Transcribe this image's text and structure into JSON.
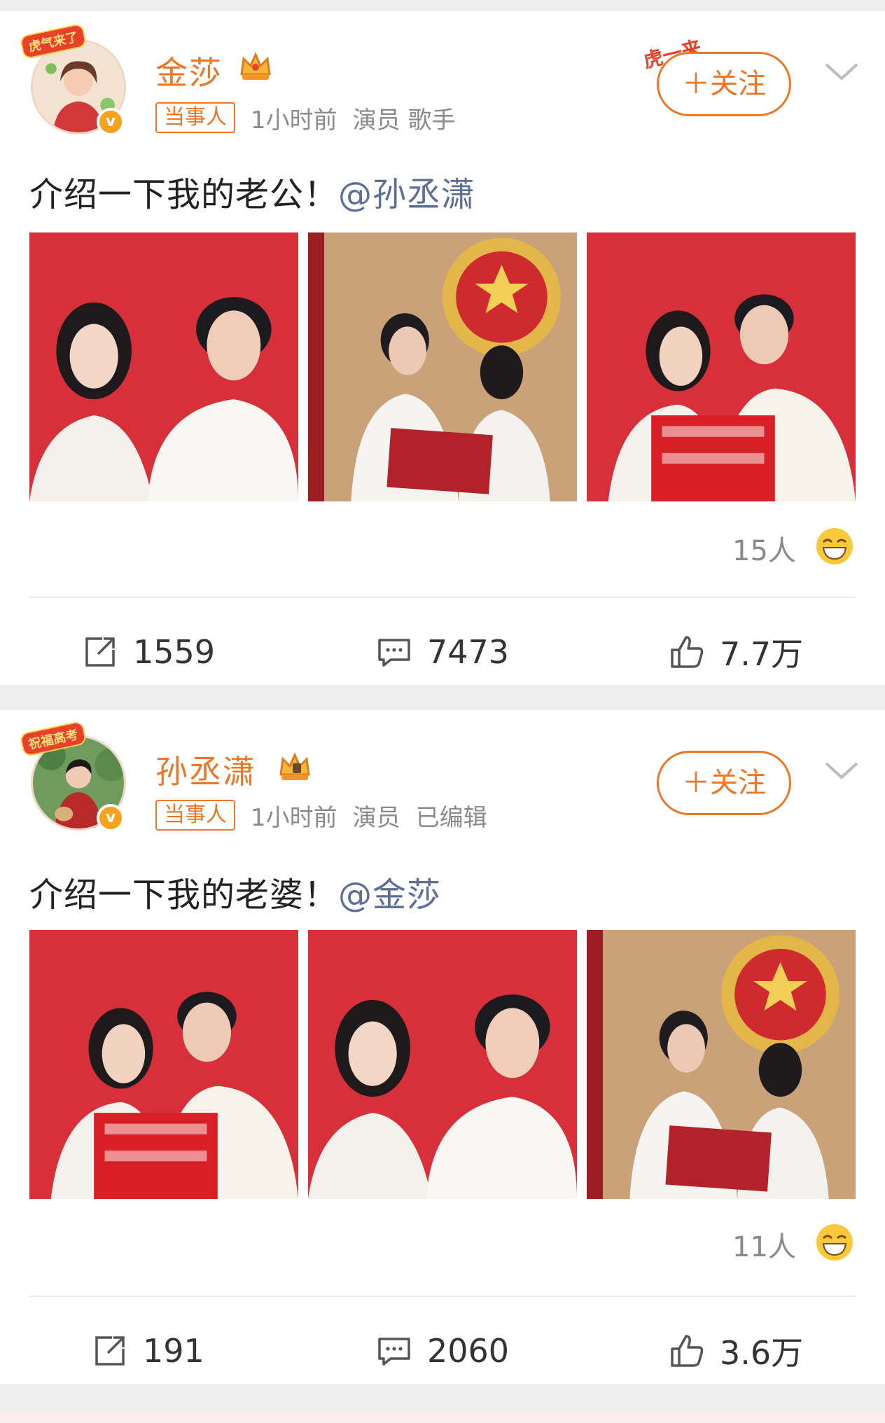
{
  "posts": [
    {
      "username": "金莎",
      "tag": "当事人",
      "time": "1小时前",
      "meta": "演员 歌手",
      "avatar_badge": "虎气来了",
      "follow_deco": "虎一来",
      "follow_label": "＋关注",
      "text": "介绍一下我的老公！",
      "mention": "@孙丞潇",
      "photos": [
        "couple-portrait-red",
        "marriage-certificate-emblem",
        "double-happiness-sign"
      ],
      "reaction_count": "15人",
      "reposts": "1559",
      "comments": "7473",
      "likes": "7.7万"
    },
    {
      "username": "孙丞潇",
      "tag": "当事人",
      "time": "1小时前",
      "meta": "演员",
      "edited": "已编辑",
      "avatar_badge": "祝福高考",
      "follow_label": "＋关注",
      "text": "介绍一下我的老婆！",
      "mention": "@金莎",
      "photos": [
        "double-happiness-sign",
        "couple-portrait-red",
        "marriage-certificate-emblem"
      ],
      "reaction_count": "11人",
      "reposts": "191",
      "comments": "2060",
      "likes": "3.6万"
    }
  ],
  "colors": {
    "accent": "#ec7727",
    "mention": "#5b6f98",
    "meta": "#8a8a8a",
    "photo_red": "#d8303a"
  },
  "icons": [
    "verified-icon",
    "crown-icon",
    "chevron-down-icon",
    "laugh-emoji-icon",
    "repost-icon",
    "comment-icon",
    "like-icon"
  ]
}
